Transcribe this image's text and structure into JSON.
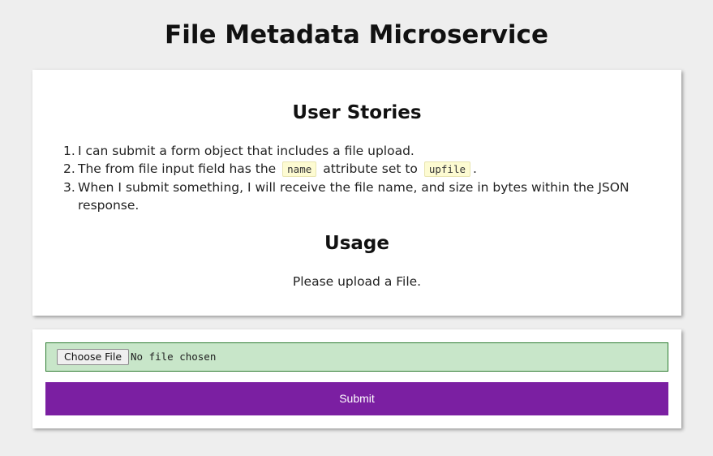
{
  "page": {
    "title": "File Metadata Microservice"
  },
  "stories": {
    "heading": "User Stories",
    "items": [
      {
        "num": "1.",
        "text": "I can submit a form object that includes a file upload."
      },
      {
        "num": "2.",
        "before": "The from file input field has the",
        "code1": "name",
        "middle": "attribute set to",
        "code2": "upfile",
        "after": "."
      },
      {
        "num": "3.",
        "text": "When I submit something, I will receive the file name, and size in bytes within the JSON response."
      }
    ]
  },
  "usage": {
    "heading": "Usage",
    "text": "Please upload a File."
  },
  "form": {
    "choose_label": "Choose File",
    "no_file_text": "No file chosen",
    "submit_label": "Submit"
  },
  "colors": {
    "background": "#eeeeee",
    "file_box_bg": "#c8e6c9",
    "file_box_border": "#2e7d32",
    "submit_bg": "#7b1fa2",
    "code_bg": "#fdfbd2"
  }
}
